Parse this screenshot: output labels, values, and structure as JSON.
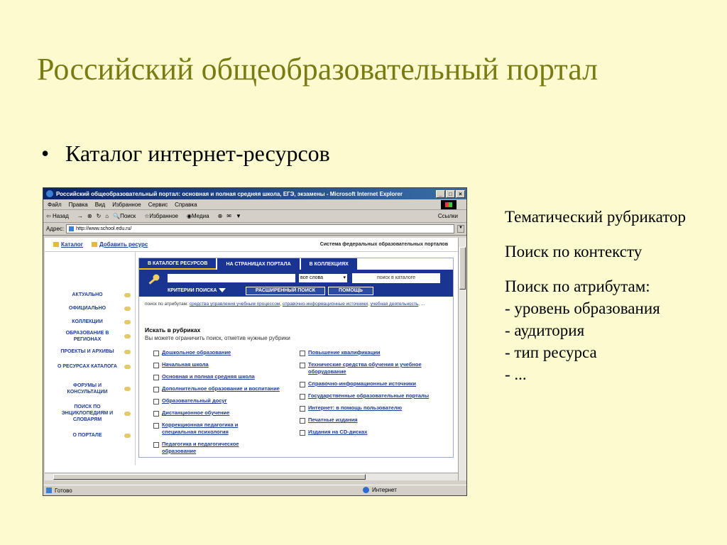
{
  "slide": {
    "title": "Российский общеобразовательный портал",
    "bullet": "Каталог интернет-ресурсов",
    "notes": {
      "line1": "Тематический рубрикатор",
      "line2": "Поиск по контексту",
      "line3": "Поиск по атрибутам:",
      "attributes": [
        "- уровень образования",
        "- аудитория",
        "- тип ресурса",
        "- ..."
      ]
    }
  },
  "browser": {
    "title": "Российский общеобразовательный портал: основная и полная средняя школа, ЕГЭ, экзамены - Microsoft Internet Explorer",
    "window_buttons": [
      "_",
      "□",
      "×"
    ],
    "menu": [
      "Файл",
      "Правка",
      "Вид",
      "Избранное",
      "Сервис",
      "Справка"
    ],
    "toolbar": [
      "Назад",
      "→",
      "⊗",
      "↻",
      "⌂",
      "Поиск",
      "Избранное",
      "Медиа",
      "⊕",
      "✉",
      "▼"
    ],
    "links_label": "Ссылки",
    "address_label": "Адрес:",
    "address_value": "http://www.school.edu.ru/",
    "status_left": "Готово",
    "status_right": "Интернет"
  },
  "page": {
    "catalog": "Каталог",
    "add_resource": "Добавить ресурс",
    "system": "Система федеральных образовательных порталов",
    "left_menu": [
      "АКТУАЛЬНО",
      "ОФИЦИАЛЬНО",
      "КОЛЛЕКЦИИ",
      "ОБРАЗОВАНИЕ В РЕГИОНАХ",
      "ПРОЕКТЫ И АРХИВЫ",
      "О РЕСУРСАХ КАТАЛОГА",
      "ФОРУМЫ И КОНСУЛЬТАЦИИ",
      "ПОИСК ПО ЭНЦИКЛОПЕДИЯМ И СЛОВАРЯМ",
      "О ПОРТАЛЕ"
    ],
    "tabs": [
      "В КАТАЛОГЕ РЕСУРСОВ",
      "НА СТРАНИЦАХ ПОРТАЛА",
      "В КОЛЛЕКЦИЯХ"
    ],
    "words_select": "все слова",
    "search_button": "поиск в каталоге",
    "criteria": "КРИТЕРИИ ПОИСКА",
    "advanced": "РАСШИРЕННЫЙ ПОИСК",
    "help": "ПОМОЩЬ",
    "attr_prefix": "поиск по атрибутам:",
    "attr_links": [
      "средства управления учебным процессом",
      "справочно-информационные источники",
      "учебная деятельность"
    ],
    "attr_suffix": "...",
    "rubric_head": "Искать в рубриках",
    "rubric_sub": "Вы можете ограничить поиск, отметив нужные рубрики",
    "rubrics_left": [
      "Дошкольное образование",
      "Начальная школа",
      "Основная и полная средняя школа",
      "Дополнительное образование и воспитание",
      "Образовательный досуг",
      "Дистанционное обучение",
      "Коррекционная педагогика и специальная психология",
      "Педагогика и педагогическое образование"
    ],
    "rubrics_right": [
      "Повышение квалификации",
      "Технические средства обучения и учебное оборудование",
      "Справочно-информационные источники",
      "Государственные образовательные порталы",
      "Интернет: в помощь пользователю",
      "Печатные издания",
      "Издания на CD-дисках"
    ]
  }
}
